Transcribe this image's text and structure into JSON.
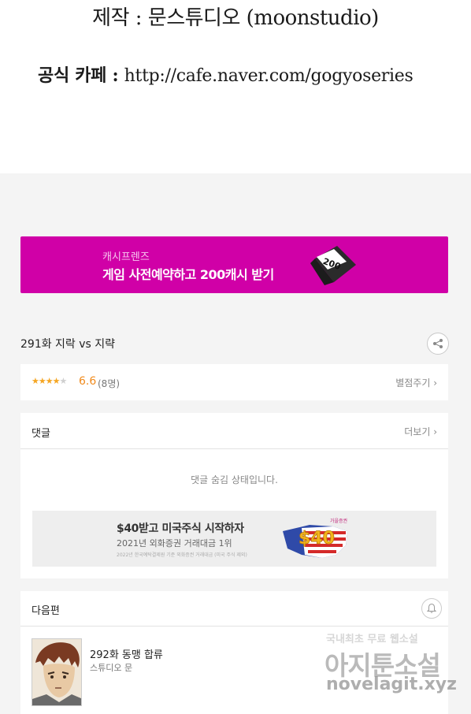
{
  "credits": {
    "production": "제작 : 문스튜디오 (moonstudio)",
    "cafe_label": "공식 카페 : ",
    "cafe_url": "http://cafe.naver.com/gogyoseries"
  },
  "promo": {
    "subtitle": "캐시프렌즈",
    "title": "게임 사전예약하고 200캐시 받기",
    "badge": "200",
    "bg_color": "#d000a7"
  },
  "episode": {
    "title": "291화 지락 vs 지략",
    "share_icon": "share-icon"
  },
  "rating": {
    "stars_filled": 3.5,
    "stars_total": 5,
    "score": "6.6",
    "count": "(8명)",
    "rate_button": "별점주기 ›",
    "star_color": "#f5a623"
  },
  "comments": {
    "heading": "댓글",
    "more_button": "더보기 ›",
    "hidden_message": "댓글 숨김 상태입니다."
  },
  "ad": {
    "title": "$40받고 미국주식 시작하자",
    "subtitle": "2021년 외화증권 거래대금 1위",
    "fine_print": "2022년 한국예탁결제원 기준 외화증권 거래대금 (미국 주식 제외)",
    "art_amount": "$40",
    "art_tag": "가을증권"
  },
  "next": {
    "heading": "다음편",
    "bell_icon": "bell-icon",
    "episode_title": "292화 동맹 합류",
    "author": "스튜디오 문"
  },
  "watermark": {
    "line1_a": "국내최초 무료",
    "line1_b": " 웹소설",
    "line2": "아지툰소설",
    "line3": "novelagit.xyz"
  }
}
